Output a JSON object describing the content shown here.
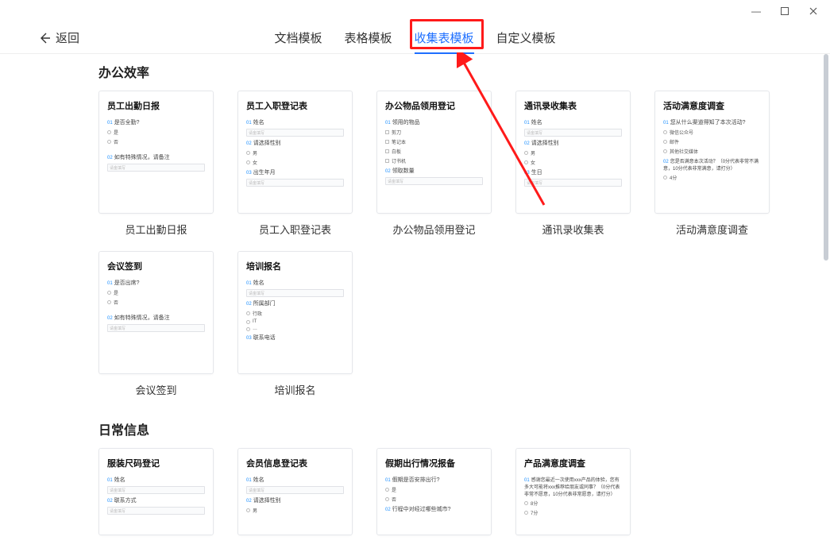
{
  "window": {
    "min": "—",
    "max": "☐",
    "close": "✕"
  },
  "back_label": "返回",
  "tabs": {
    "t0": "文档模板",
    "t1": "表格模板",
    "t2": "收集表模板",
    "t3": "自定义模板",
    "active": 2
  },
  "sections": {
    "s0_title": "办公效率",
    "s1_title": "日常信息"
  },
  "cards": {
    "attendance": {
      "title": "员工出勤日报",
      "name": "员工出勤日报",
      "q1": "是否全勤?",
      "opt1": "是",
      "opt2": "否",
      "q2": "如有特殊情况，请备注",
      "ph": ""
    },
    "onboarding": {
      "title": "员工入职登记表",
      "name": "员工入职登记表",
      "q1": "姓名",
      "q2": "请选择性别",
      "opt1": "男",
      "opt2": "女",
      "q3": "出生年月"
    },
    "supplies": {
      "title": "办公物品领用登记",
      "name": "办公物品领用登记",
      "q1": "领用的物品",
      "opt1": "剪刀",
      "opt2": "笔记本",
      "opt3": "白板",
      "opt4": "订书机",
      "q2": "领取数量"
    },
    "contacts": {
      "title": "通讯录收集表",
      "name": "通讯录收集表",
      "q1": "姓名",
      "q2": "请选择性别",
      "opt1": "男",
      "opt2": "女",
      "q3": "生日"
    },
    "satisfaction": {
      "title": "活动满意度调查",
      "name": "活动满意度调查",
      "q1": "您从什么渠道得知了本次活动?",
      "opt1": "微信公众号",
      "opt2": "邮件",
      "opt3": "其他社交媒体",
      "q2": "您是否满意本次活动？（0分代表非常不满意，10分代表非常满意，请打分）",
      "opt4": "4分"
    },
    "meeting": {
      "title": "会议签到",
      "name": "会议签到",
      "q1": "是否出席?",
      "opt1": "是",
      "opt2": "否",
      "q2": "如有特殊情况，请备注"
    },
    "training": {
      "title": "培训报名",
      "name": "培训报名",
      "q1": "姓名",
      "q2": "所属部门",
      "opt1": "行政",
      "opt2": "IT",
      "opt3": "…",
      "q3": "联系电话"
    },
    "clothing": {
      "title": "服装尺码登记",
      "name": "服装尺码登记",
      "q1": "姓名",
      "q2": "联系方式"
    },
    "member": {
      "title": "会员信息登记表",
      "name": "会员信息登记表",
      "q1": "姓名",
      "q2": "请选择性别",
      "opt1": "男"
    },
    "holiday": {
      "title": "假期出行情况报备",
      "name": "假期出行情况报备",
      "q1": "假期是否安排出行?",
      "opt1": "是",
      "opt2": "否",
      "q2": "行程中对经过哪些城市?"
    },
    "product_sat": {
      "title": "产品满意度调查",
      "name": "产品满意度调查",
      "q1": "感谢您最近一次使用xxx产品的体验，您有多大可能将xxx推荐给朋友或同事？（0分代表非常不愿意，10分代表非常愿意，请打分）",
      "opt1": "8分",
      "opt2": "7分"
    }
  },
  "placeholder": "请金填写"
}
